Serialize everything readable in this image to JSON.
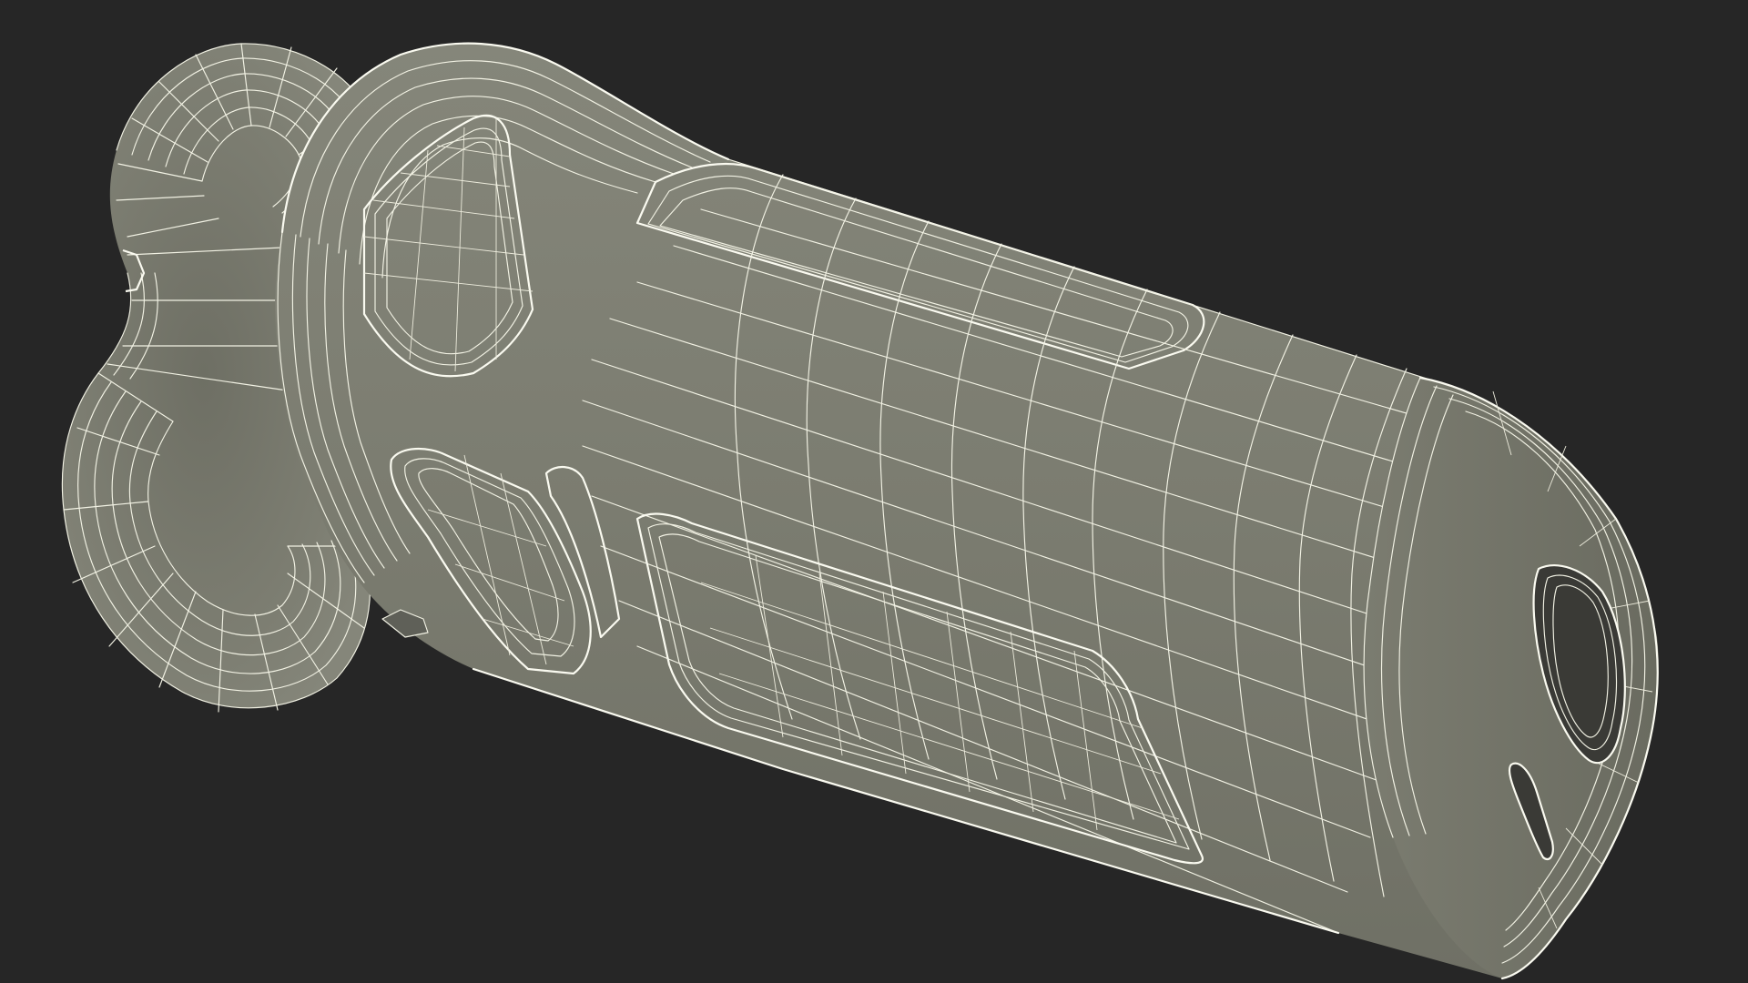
{
  "scene": {
    "background_color": "#262626",
    "subject": "wireframe-mesh-3d-model",
    "mesh_fill_color": "#7a7b6f",
    "wire_color": "#f2f2e4"
  }
}
